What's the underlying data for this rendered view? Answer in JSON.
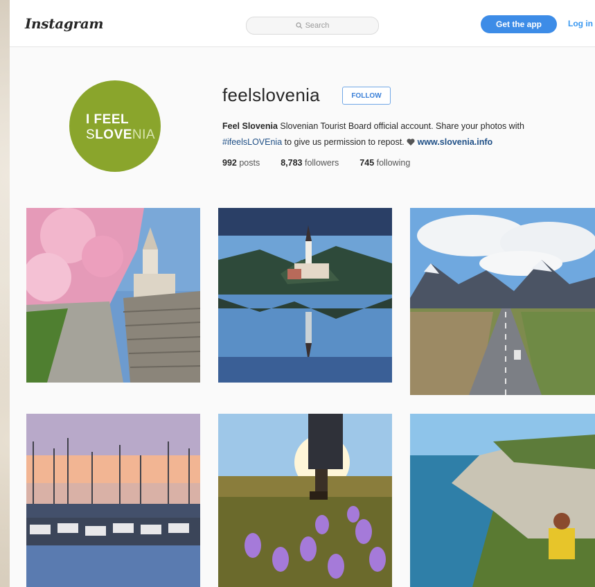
{
  "header": {
    "logo": "Instagram",
    "search_placeholder": "Search",
    "get_app_label": "Get the app",
    "login_label": "Log in"
  },
  "profile": {
    "avatar_line1": "I FEEL",
    "avatar_line2_s": "S",
    "avatar_line2_love": "LOVE",
    "avatar_line2_nia": "NIA",
    "username": "feelslovenia",
    "follow_label": "FOLLOW",
    "full_name": "Feel Slovenia",
    "bio_text_1": " Slovenian Tourist Board official account. Share your photos with",
    "bio_hashtag": "#ifeelsLOVEnia",
    "bio_text_2": " to give us permission to repost. ",
    "bio_link": "www.slovenia.info",
    "posts_count": "992",
    "posts_label": " posts",
    "followers_count": "8,783",
    "followers_label": " followers",
    "following_count": "745",
    "following_label": " following"
  },
  "colors": {
    "brand_blue": "#3d8ce7",
    "avatar_green": "#8aa52c"
  },
  "photos": [
    {
      "name": "photo-magnolia-church-stairs"
    },
    {
      "name": "photo-lake-bled-island"
    },
    {
      "name": "photo-mountain-road"
    },
    {
      "name": "photo-marina-sunset"
    },
    {
      "name": "photo-hiker-crocus-meadow"
    },
    {
      "name": "photo-coastal-cliff"
    }
  ]
}
